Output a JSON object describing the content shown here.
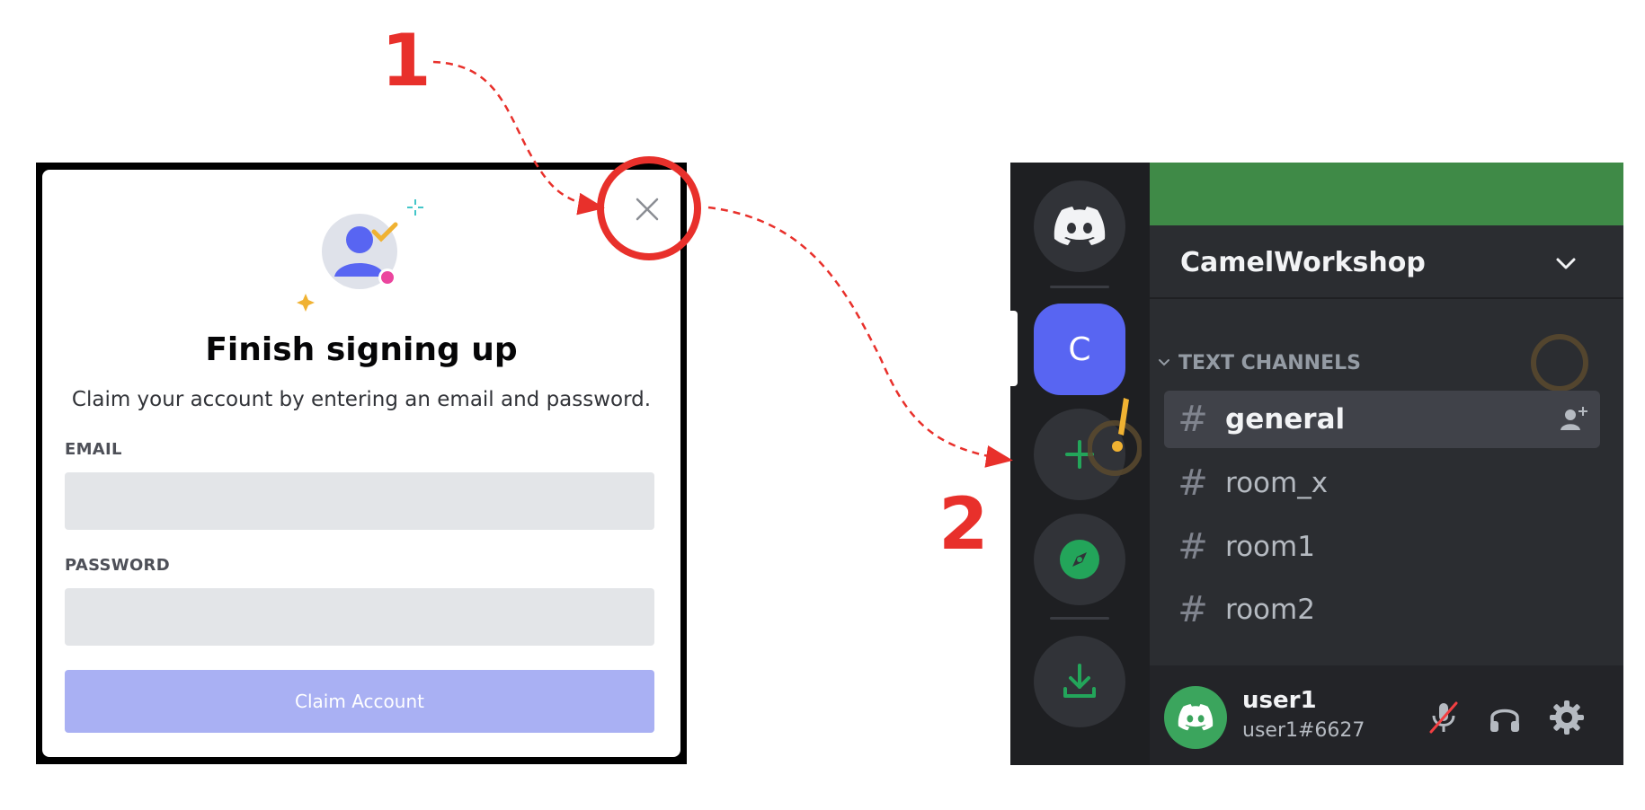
{
  "annotations": {
    "step1": "1",
    "step2": "2",
    "arrow_color": "#e8302b"
  },
  "modal": {
    "title": "Finish signing up",
    "subtitle": "Claim your account by entering an email and password.",
    "email_label": "EMAIL",
    "email_value": "",
    "password_label": "PASSWORD",
    "password_value": "",
    "claim_button": "Claim Account",
    "close_icon": "close-icon",
    "illustration_icon": "user-check-icon"
  },
  "discord": {
    "server_letter": "C",
    "server_name": "CamelWorkshop",
    "category": "TEXT CHANNELS",
    "channels": [
      {
        "name": "general",
        "active": true
      },
      {
        "name": "room_x",
        "active": false
      },
      {
        "name": "room1",
        "active": false
      },
      {
        "name": "room2",
        "active": false
      }
    ],
    "user": {
      "name": "user1",
      "tag": "user1#6627"
    },
    "colors": {
      "blurple": "#5865f2",
      "green": "#3ba55d",
      "banner": "#3f8a47"
    }
  }
}
